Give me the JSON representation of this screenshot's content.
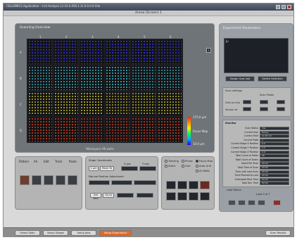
{
  "app": {
    "window_title": "CELLOMICS Application - Cell Analysis (3.14.0.456.1.3) 0.0.0.0 Alla",
    "screen_title": "Arena (Screen) 1"
  },
  "display": {
    "title": "Scanning Overview",
    "col_labels": [
      "1",
      "2",
      "3",
      "4",
      "5",
      "6"
    ],
    "row_labels": [
      "A",
      "B",
      "C",
      "D"
    ],
    "colorbar_labels": {
      "top": "175.0 µm",
      "mid": "Focus Map",
      "bottom": "10.0 µm"
    },
    "scale_text": "Workspace 96 wells",
    "info_button": "i",
    "row_colors": [
      "#3b3cf0",
      "#3ac8e0",
      "#d9d030",
      "#e4432a"
    ]
  },
  "right": {
    "title": "Experiment Parameters",
    "editor_text": "Ju",
    "btn_assign": "Assign Scan Job",
    "btn_delete": "Delete Selection",
    "scan_settings_label": "Scan settings",
    "scan_settings_fields": [
      "Scan Fields",
      "Grid on-line",
      "Sensor at"
    ],
    "monitor_title": "Monitor",
    "monitor_rows": [
      {
        "k": "Scan Status",
        "v": "Idle"
      },
      {
        "k": "Current task",
        "v": "Ready"
      },
      {
        "k": "Current Field",
        "v": "A1 B2 C3"
      },
      {
        "k": "Current Plate",
        "v": "1"
      },
      {
        "k": "Current Stage X Position",
        "v": "0.0"
      },
      {
        "k": "Current Stage Y Position",
        "v": "0.0"
      },
      {
        "k": "Current Stage Z Position",
        "v": "0.0"
      },
      {
        "k": "Total Count of Fields",
        "v": "96"
      },
      {
        "k": "Total Count of Scans",
        "v": "1"
      },
      {
        "k": "Spent Per Scan",
        "v": "00:00"
      },
      {
        "k": "Total Time of Scan",
        "v": "00:00"
      },
      {
        "k": "Time until next Scan",
        "v": "00:00"
      },
      {
        "k": "Time Planned to Last",
        "v": "00:00"
      },
      {
        "k": "Estimated Rest Time",
        "v": "00:00"
      },
      {
        "k": "Total Run Time",
        "v": "00:00"
      }
    ],
    "load_labels": [
      "Load Status",
      "Queue Items",
      "Write Status"
    ],
    "load_values": [
      "Load 0 of 7",
      "Item 0 of 0",
      "0.0 %"
    ]
  },
  "bottom": {
    "left_tabs": [
      "Pattern",
      "All",
      "Edit",
      "Track",
      "Paste"
    ],
    "coord_title": "Stage Coordinates",
    "coord_values": [
      "1 µm",
      "Move To"
    ],
    "coord_headers": [
      "X pos",
      "Y pos"
    ],
    "manual_title": "Manual Position Adjustment",
    "manual_buttons": [
      "Set Well",
      "Go to",
      "Calibrate"
    ],
    "right_radios": [
      {
        "label": "Tracking",
        "on": false
      },
      {
        "label": "Phase",
        "on": false
      },
      {
        "label": "Focus Map",
        "on": true
      },
      {
        "label": "Stitch",
        "on": false
      },
      {
        "label": "Grid",
        "on": false
      },
      {
        "label": "Auto Grid",
        "on": false
      },
      {
        "label": "All Wells",
        "on": false
      }
    ]
  },
  "nav": {
    "tabs": [
      "Select Stain",
      "Setup Stages",
      "Setup Jobs",
      "Setup Experiment"
    ],
    "active_index": 3,
    "right_tab": "Scan Results"
  }
}
